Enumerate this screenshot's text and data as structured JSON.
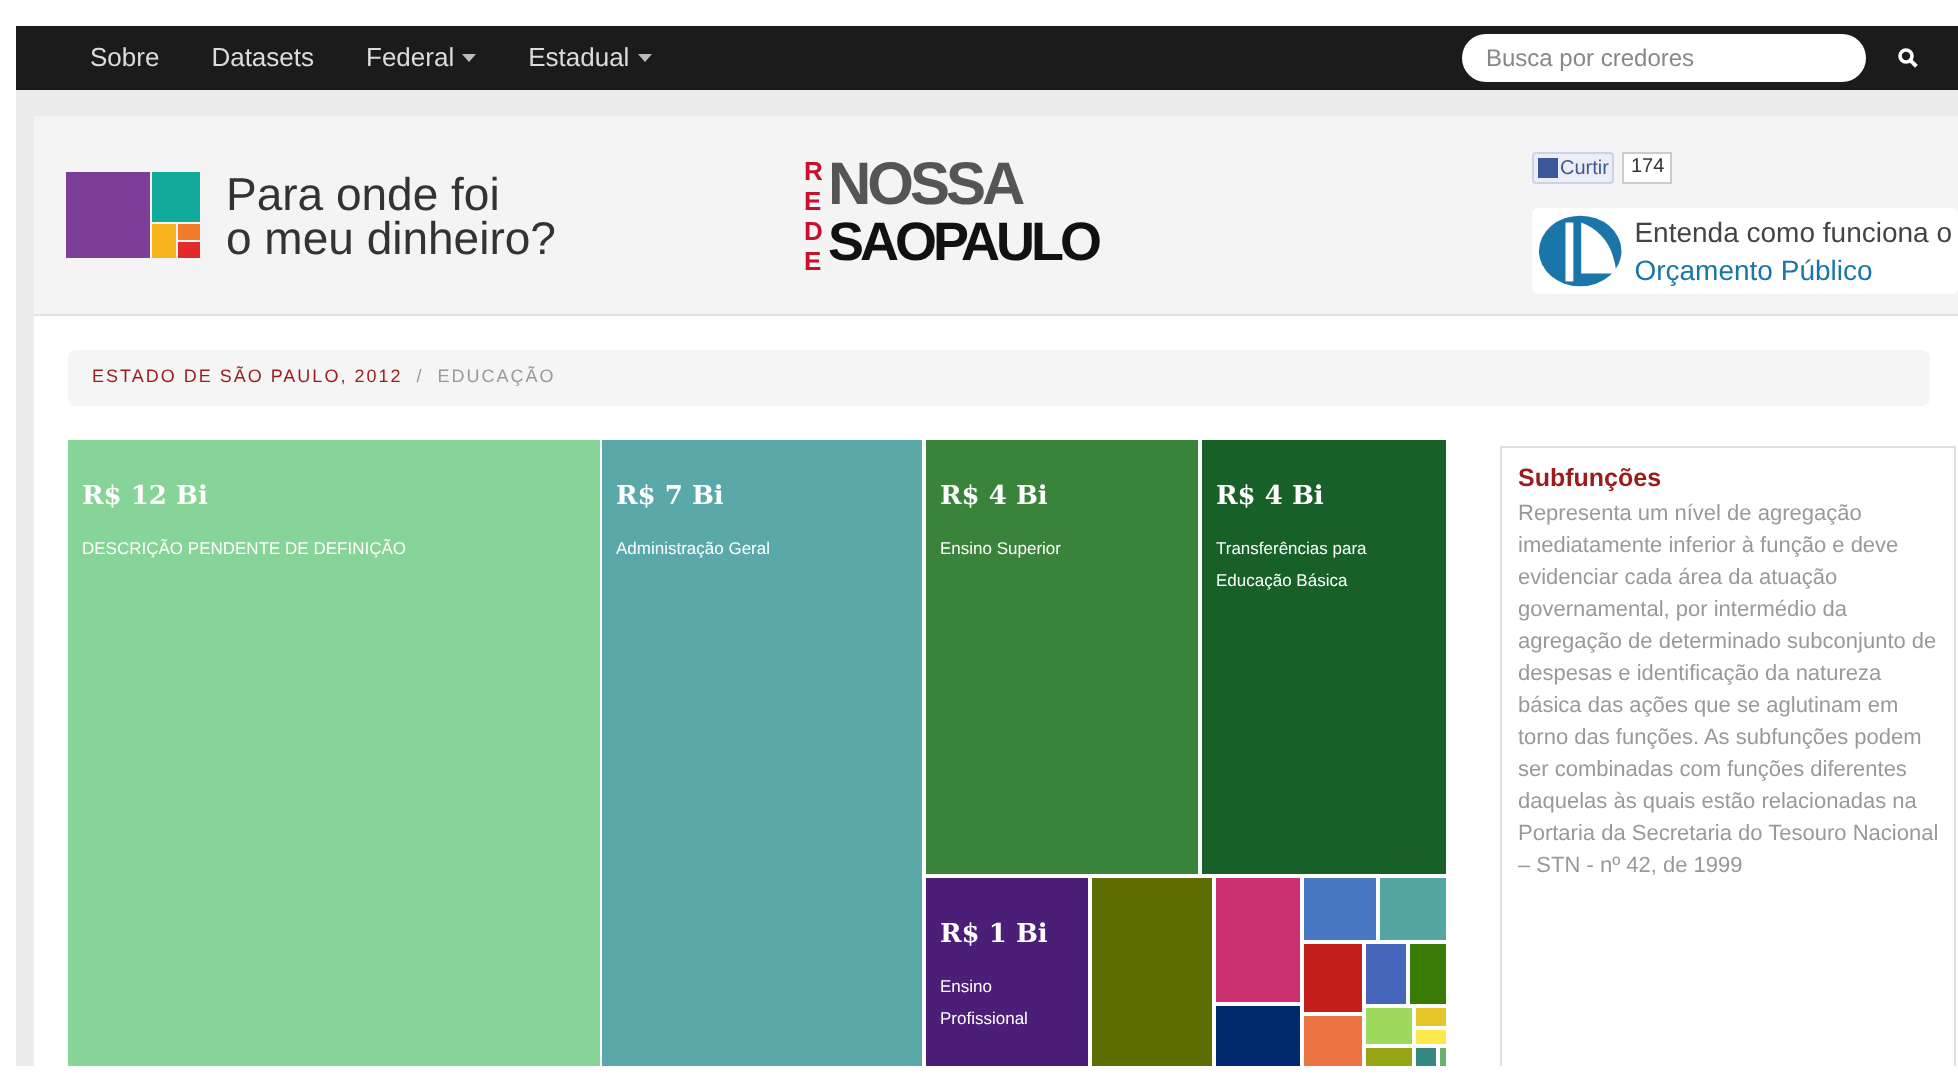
{
  "navbar": {
    "items": [
      {
        "label": "Sobre",
        "dropdown": false
      },
      {
        "label": "Datasets",
        "dropdown": false
      },
      {
        "label": "Federal",
        "dropdown": true
      },
      {
        "label": "Estadual",
        "dropdown": true
      }
    ],
    "search": {
      "placeholder": "Busca por credores"
    }
  },
  "header": {
    "site_title": [
      "Para onde foi",
      "o meu dinheiro?"
    ],
    "partner_logo": {
      "vertical": "REDE",
      "top": "NOSSA",
      "bottom": "SAOPAULO"
    },
    "like_button": {
      "label": "Curtir",
      "count": "174"
    },
    "budget_link": [
      "Entenda como funciona o",
      "Orçamento Público"
    ]
  },
  "breadcrumb": {
    "separator": "/",
    "items": [
      {
        "label": "ESTADO DE SÃO PAULO, 2012",
        "selected": false
      },
      {
        "label": "EDUCAÇÃO",
        "selected": true
      }
    ]
  },
  "treemap": [
    {
      "value": "R$ 12 Bi",
      "label": "DESCRIÇÃO PENDENTE DE DEFINIÇÃO",
      "color": "#86d498"
    },
    {
      "value": "R$ 7 Bi",
      "label": "Administração Geral",
      "color": "#5aa9a8"
    },
    {
      "value": "R$ 4 Bi",
      "label": "Ensino Superior",
      "color": "#39833a"
    },
    {
      "value": "R$ 4 Bi",
      "label": "Transferências para Educação Básica",
      "color": "#176128"
    },
    {
      "value": "R$ 1 Bi",
      "label": "Ensino Profissional",
      "color": "#4b1f77"
    },
    {
      "color": "#5f6e00"
    },
    {
      "color": "#cb3070"
    },
    {
      "color": "#00296e"
    },
    {
      "color": "#4878c4"
    },
    {
      "color": "#55a6a0"
    },
    {
      "color": "#c41f1a"
    },
    {
      "color": "#4666bb"
    },
    {
      "color": "#3a7b08"
    },
    {
      "color": "#ec7440"
    },
    {
      "color": "#9cd95c"
    },
    {
      "color": "#e8c62a"
    },
    {
      "color": "#fde94b"
    },
    {
      "color": "#95a514"
    },
    {
      "color": "#368781"
    },
    {
      "color": "#67b36b"
    }
  ],
  "info_panel": {
    "title": "Subfunções",
    "text": "Representa um nível de agregação imediatamente inferior à função e deve evidenciar cada área da atuação governamental, por intermédio da agregação de determinado subconjunto de despesas e identificação da natureza básica das ações que se aglutinam em torno das funções. As subfunções podem ser combinadas com funções diferentes daquelas às quais estão relacionadas na Portaria da Secretaria do Tesouro Nacional – STN - nº 42, de 1999"
  }
}
